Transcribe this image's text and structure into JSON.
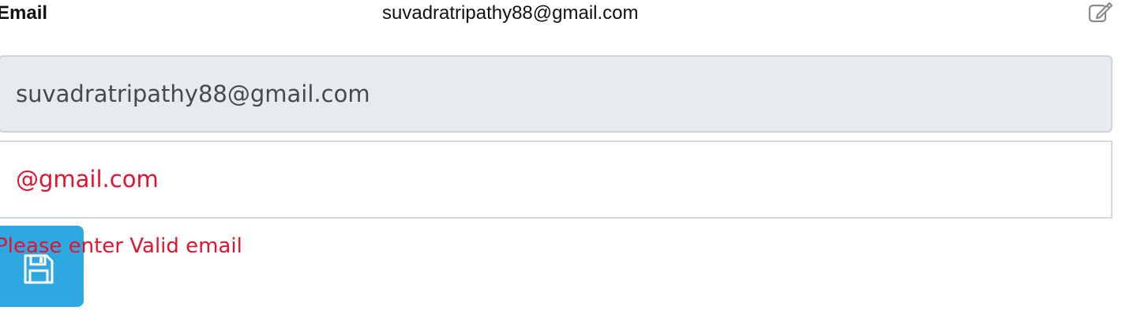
{
  "field": {
    "label": "Email",
    "current_value": "suvadratripathy88@gmail.com",
    "edit_icon": "edit-icon"
  },
  "form": {
    "readonly_value": "suvadratripathy88@gmail.com",
    "edit_value": "@gmail.com",
    "error_message": "Please enter Valid email",
    "save_icon": "save-icon"
  },
  "colors": {
    "error": "#e8112d",
    "save_button": "#2ea8e0",
    "readonly_bg": "#e8ebee"
  }
}
